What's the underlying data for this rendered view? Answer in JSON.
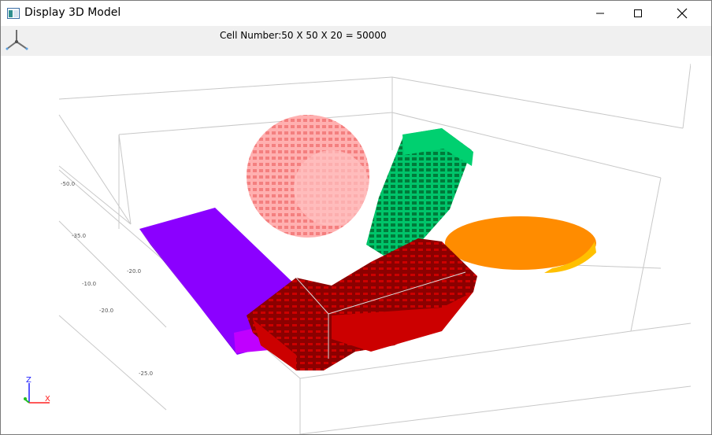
{
  "window": {
    "title": "Display 3D Model"
  },
  "toolbar": {
    "cell_number": "Cell Number:50 X 50 X 20 = 50000"
  },
  "scene": {
    "ticks": [
      "-50.0",
      "-35.0",
      "-20.0",
      "-10.0",
      "-20.0",
      "-25.0"
    ],
    "orientation": {
      "z": "Z",
      "x": "X"
    },
    "colors": {
      "purple": "#8b00ff",
      "sphere": "#ff9e9e",
      "green": "#00a852",
      "orange": "#ff8c00",
      "darkred": "#8b0000",
      "red": "#cc0000"
    }
  },
  "icons": {
    "app": "app-window-icon",
    "axes": "axes-icon",
    "minimize": "minimize-icon",
    "maximize": "maximize-icon",
    "close": "close-icon"
  }
}
